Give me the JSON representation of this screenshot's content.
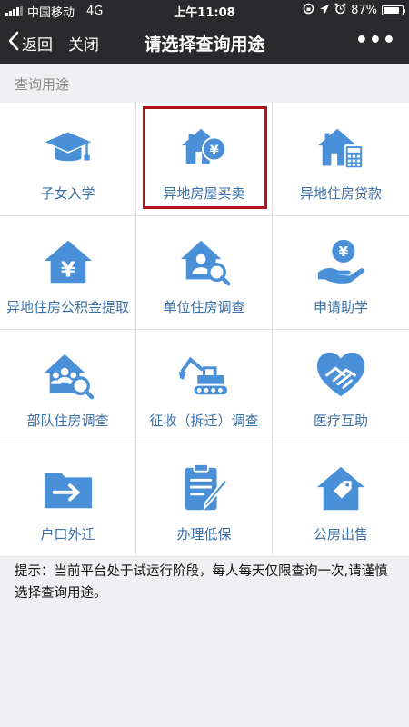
{
  "status_bar": {
    "carrier": "中国移动",
    "network": "4G",
    "time": "上午11:08",
    "battery": "87%",
    "battery_level": 0.87
  },
  "nav": {
    "back_label": "返回",
    "close_label": "关闭",
    "title": "请选择查询用途",
    "more_label": "•••"
  },
  "section_label": "查询用途",
  "colors": {
    "accent": "#4a90d9",
    "label": "#3a6fa8",
    "highlight_border": "#b0151b",
    "nav_background": "#2a2a2c"
  },
  "items": [
    {
      "label": "子女入学",
      "icon": "graduation-cap-icon"
    },
    {
      "label": "异地房屋买卖",
      "icon": "house-yen-icon",
      "highlighted": true
    },
    {
      "label": "异地住房贷款",
      "icon": "house-calculator-icon"
    },
    {
      "label": "异地住房公积金提取",
      "icon": "house-yen-roof-icon"
    },
    {
      "label": "单位住房调查",
      "icon": "house-person-search-icon"
    },
    {
      "label": "申请助学",
      "icon": "hand-yen-coin-icon"
    },
    {
      "label": "部队住房调查",
      "icon": "house-group-search-icon"
    },
    {
      "label": "征收（拆迁）调查",
      "icon": "excavator-icon"
    },
    {
      "label": "医疗互助",
      "icon": "heart-handshake-icon"
    },
    {
      "label": "户口外迁",
      "icon": "folder-arrow-icon"
    },
    {
      "label": "办理低保",
      "icon": "clipboard-pen-icon"
    },
    {
      "label": "公房出售",
      "icon": "house-tag-icon"
    }
  ],
  "notice": "提示：当前平台处于试运行阶段，每人每天仅限查询一次,请谨慎选择查询用途。"
}
